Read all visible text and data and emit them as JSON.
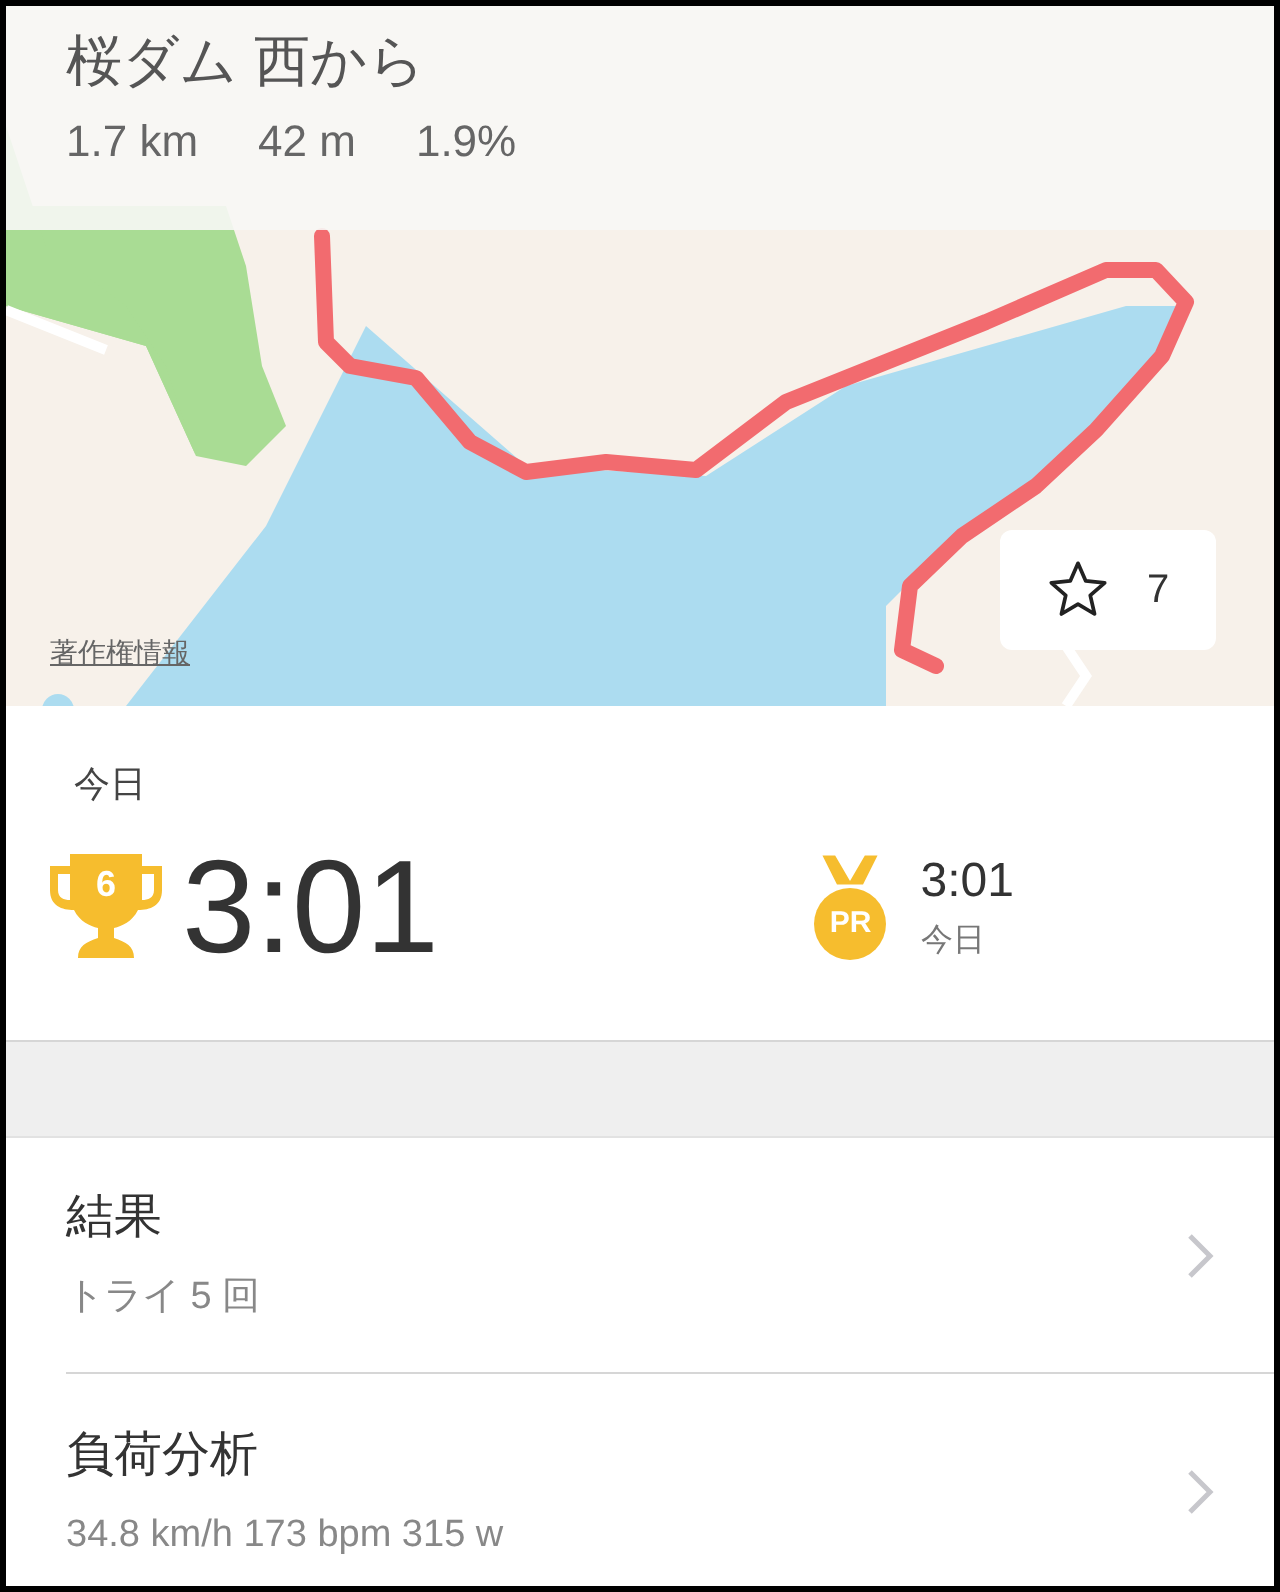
{
  "segment": {
    "title": "桜ダム 西から",
    "stats": [
      "1.7 km",
      "42 m",
      "1.9%"
    ]
  },
  "map": {
    "kind": "picture",
    "copyright_link": "著作権情報",
    "star_button": {
      "count": "7"
    }
  },
  "effort": {
    "date_label": "今日",
    "rank": "6",
    "time": "3:01",
    "pr": {
      "badge": "PR",
      "time": "3:01",
      "date": "今日"
    }
  },
  "rows": [
    {
      "title": "結果",
      "subtitle": "トライ 5 回"
    },
    {
      "title": "負荷分析",
      "subtitle": "34.8 km/h 173 bpm 315 w"
    }
  ]
}
